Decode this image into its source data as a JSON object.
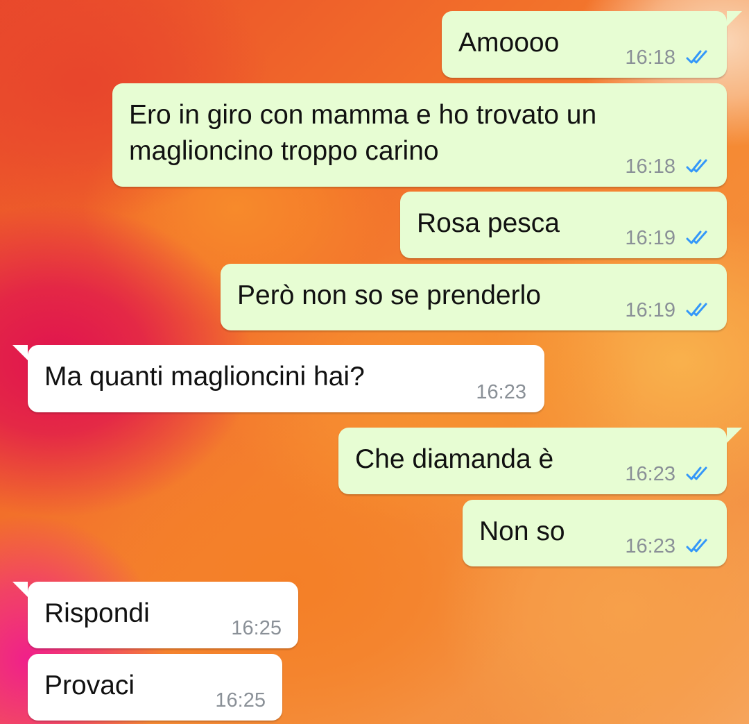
{
  "colors": {
    "outgoing_bubble": "#e7fdd3",
    "incoming_bubble": "#ffffff",
    "read_ticks": "#3497f9",
    "timestamp": "#8a9097"
  },
  "messages": [
    {
      "direction": "out",
      "text": "Amoooo",
      "time": "16:18",
      "status_icon": "double-check-read-icon"
    },
    {
      "direction": "out",
      "text": "Ero in giro con mamma e ho trovato un maglioncino troppo carino",
      "time": "16:18",
      "status_icon": "double-check-read-icon"
    },
    {
      "direction": "out",
      "text": "Rosa pesca",
      "time": "16:19",
      "status_icon": "double-check-read-icon"
    },
    {
      "direction": "out",
      "text": "Però non so se prenderlo",
      "time": "16:19",
      "status_icon": "double-check-read-icon"
    },
    {
      "direction": "in",
      "text": "Ma quanti maglioncini hai?",
      "time": "16:23"
    },
    {
      "direction": "out",
      "text": "Che diamanda è",
      "time": "16:23",
      "status_icon": "double-check-read-icon"
    },
    {
      "direction": "out",
      "text": "Non so",
      "time": "16:23",
      "status_icon": "double-check-read-icon"
    },
    {
      "direction": "in",
      "text": "Rispondi",
      "time": "16:25"
    },
    {
      "direction": "in",
      "text": "Provaci",
      "time": "16:25"
    }
  ]
}
